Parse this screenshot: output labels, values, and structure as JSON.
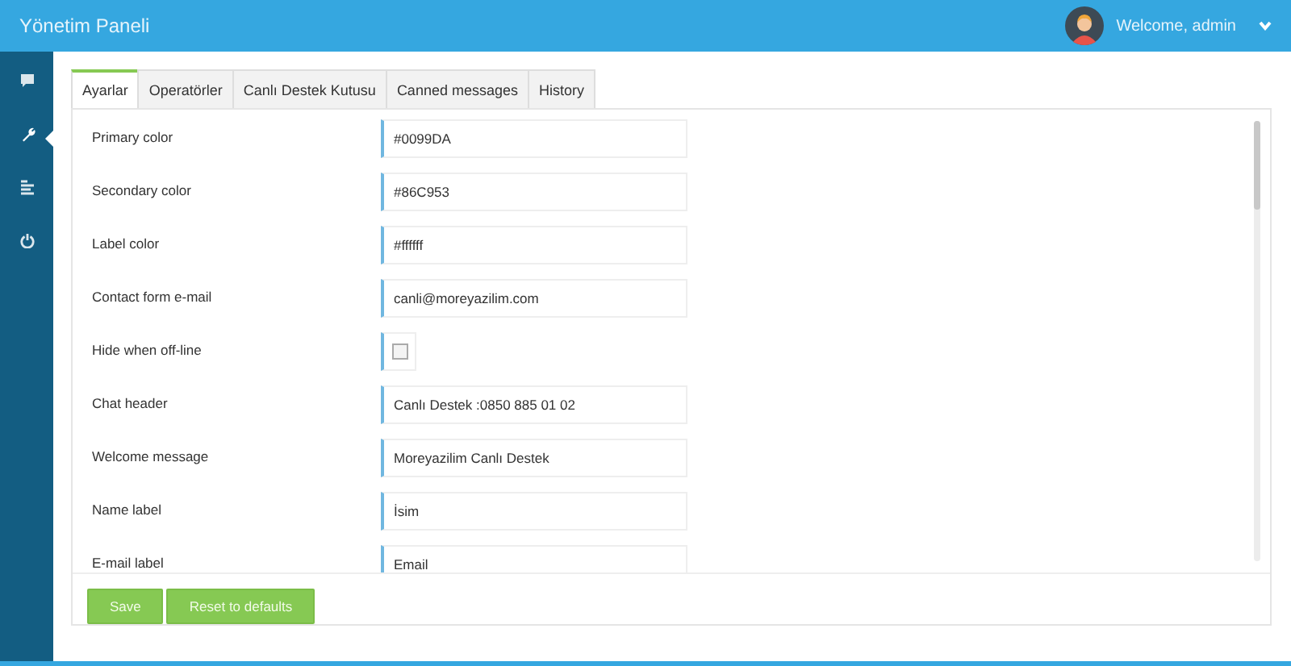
{
  "header": {
    "title": "Yönetim Paneli",
    "user": "Welcome, admin"
  },
  "sidebar": {
    "items": [
      {
        "kind": "chat",
        "selected": false
      },
      {
        "kind": "wrench",
        "selected": true
      },
      {
        "kind": "list",
        "selected": false
      },
      {
        "kind": "power",
        "selected": false
      }
    ]
  },
  "tabs": [
    {
      "label": "Ayarlar",
      "selected": true
    },
    {
      "label": "Operatörler",
      "selected": false
    },
    {
      "label": "Canlı Destek Kutusu",
      "selected": false
    },
    {
      "label": "Canned messages",
      "selected": false
    },
    {
      "label": "History",
      "selected": false
    }
  ],
  "fields": [
    {
      "kind": "text",
      "label": "Primary color",
      "value": "#0099DA"
    },
    {
      "kind": "text",
      "label": "Secondary color",
      "value": "#86C953"
    },
    {
      "kind": "text",
      "label": "Label color",
      "value": "#ffffff"
    },
    {
      "kind": "text",
      "label": "Contact form e-mail",
      "value": "canli@moreyazilim.com"
    },
    {
      "kind": "checkbox",
      "label": "Hide when off-line",
      "checked": false
    },
    {
      "kind": "text",
      "label": "Chat header",
      "value": "Canlı Destek :0850 885 01 02"
    },
    {
      "kind": "text",
      "label": "Welcome message",
      "value": "Moreyazilim Canlı Destek"
    },
    {
      "kind": "text",
      "label": "Name label",
      "value": "İsim"
    },
    {
      "kind": "text",
      "label": "E-mail label",
      "value": "Email"
    }
  ],
  "buttons": [
    "Save",
    "Reset to defaults"
  ]
}
